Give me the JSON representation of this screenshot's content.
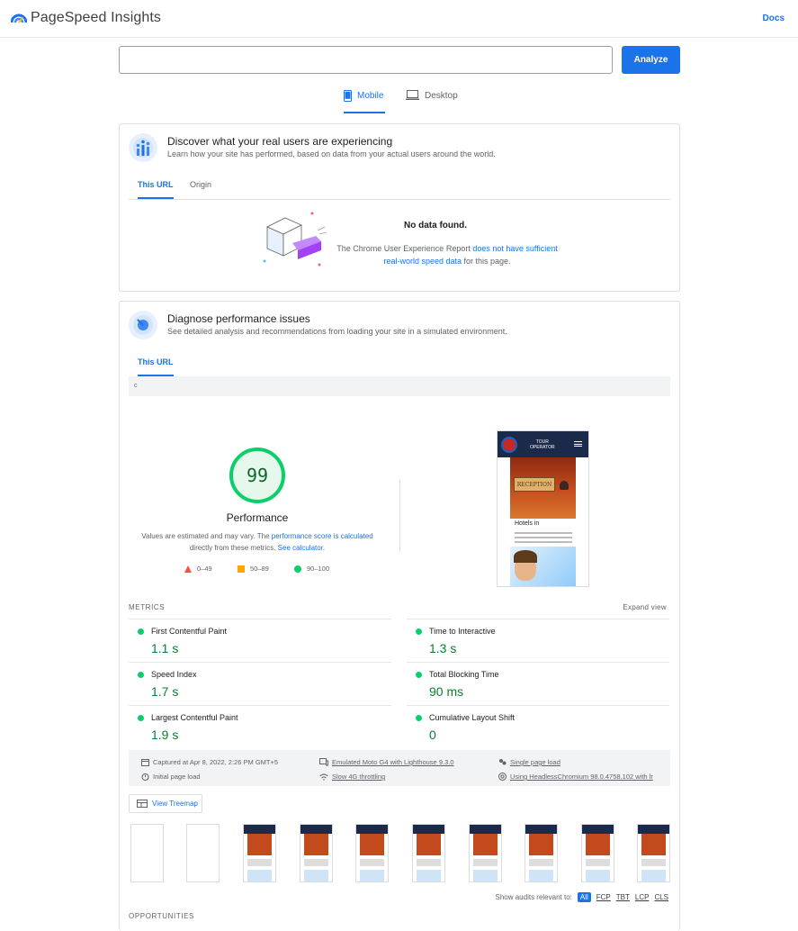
{
  "header": {
    "brand": "PageSpeed Insights",
    "docs_label": "Docs"
  },
  "search": {
    "url_value": "",
    "analyze_label": "Analyze"
  },
  "device_tabs": [
    {
      "label": "Mobile",
      "active": true
    },
    {
      "label": "Desktop",
      "active": false
    }
  ],
  "field_data": {
    "title": "Discover what your real users are experiencing",
    "subtitle": "Learn how your site has performed, based on data from your actual users around the world.",
    "tabs": [
      {
        "label": "This URL"
      },
      {
        "label": "Origin"
      }
    ],
    "nodata_title": "No data found.",
    "nodata_text_before": "The Chrome User Experience Report ",
    "nodata_link": "does not have sufficient real-world speed data",
    "nodata_text_after": " for this page."
  },
  "lab": {
    "title": "Diagnose performance issues",
    "subtitle": "See detailed analysis and recommendations from loading your site in a simulated environment.",
    "tab": "This URL",
    "url_text": "c",
    "score": 99,
    "category": "Performance",
    "note_before": "Values are estimated and may vary. The ",
    "note_link": "performance score is calculated",
    "note_middle": " directly from these metrics. ",
    "note_link2": "See calculator.",
    "legend": [
      {
        "range": "0–49",
        "color": "#ff4e42"
      },
      {
        "range": "50–89",
        "color": "#ffa400"
      },
      {
        "range": "90–100",
        "color": "#0cce6b"
      }
    ],
    "screenshot": {
      "brand_line1": "TOUR",
      "brand_line2": "OPERATOR",
      "sign": "RECEPTION",
      "heading": "Hotels in"
    },
    "metrics_label": "METRICS",
    "expand_label": "Expand view",
    "metrics": [
      {
        "name": "First Contentful Paint",
        "value": "1.1 s"
      },
      {
        "name": "Time to Interactive",
        "value": "1.3 s"
      },
      {
        "name": "Speed Index",
        "value": "1.7 s"
      },
      {
        "name": "Total Blocking Time",
        "value": "90 ms"
      },
      {
        "name": "Largest Contentful Paint",
        "value": "1.9 s"
      },
      {
        "name": "Cumulative Layout Shift",
        "value": "0"
      }
    ],
    "info": {
      "captured": "Captured at Apr 8, 2022, 2:26 PM GMT+5",
      "device": "Emulated Moto G4 with Lighthouse 9.3.0",
      "session": "Single page load",
      "initial": "Initial page load",
      "throttle": "Slow 4G throttling",
      "browser": "Using HeadlessChromium 98.0.4758.102 with lr"
    },
    "treemap_label": "View Treemap",
    "audits_label": "Show audits relevant to:",
    "audit_filters": [
      "All",
      "FCP",
      "TBT",
      "LCP",
      "CLS"
    ],
    "opportunities_label": "OPPORTUNITIES"
  }
}
